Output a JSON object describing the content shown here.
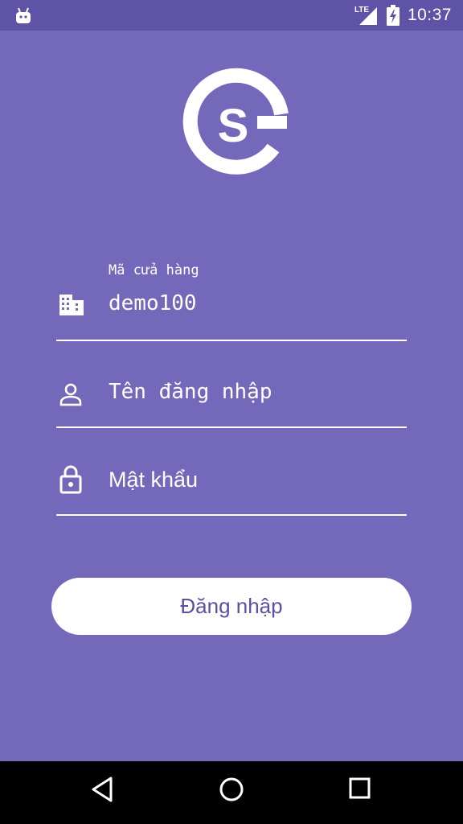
{
  "status_bar": {
    "time": "10:37",
    "network": "LTE",
    "icons": [
      "android-icon",
      "lte-signal-icon",
      "battery-charging-icon"
    ]
  },
  "logo": {
    "icon": "app-logo-icon",
    "glyph": "S"
  },
  "form": {
    "store_code": {
      "label": "Mã cửa hàng",
      "value": "demo100",
      "icon": "building-icon"
    },
    "username": {
      "placeholder": "Tên đăng nhập",
      "icon": "person-icon"
    },
    "password": {
      "placeholder": "Mật khẩu",
      "icon": "lock-icon"
    },
    "login_label": "Đăng nhập"
  },
  "nav_bar": {
    "icons": [
      "back-icon",
      "home-icon",
      "recents-icon"
    ]
  },
  "colors": {
    "background": "#7468BA",
    "status_bar": "#5F53A8",
    "button_text": "#5B4FA3",
    "nav_bar": "#000000"
  }
}
